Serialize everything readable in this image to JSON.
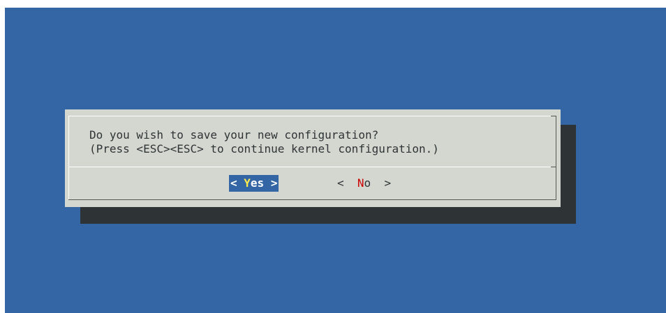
{
  "dialog": {
    "message_line1": "Do you wish to save your new configuration?",
    "message_line2": "(Press <ESC><ESC> to continue kernel configuration.)"
  },
  "buttons": {
    "yes": {
      "left": "<",
      "hotkey": "Y",
      "rest": "es",
      "right": ">"
    },
    "no": {
      "left": "<",
      "hotkey": "N",
      "rest": "o",
      "right": ">"
    }
  },
  "colors": {
    "background": "#3465a4",
    "dialog": "#d3d7cf",
    "shadow": "#2e3436",
    "selected_button": "#3465a4",
    "hotkey_selected": "#fce94f",
    "hotkey": "#cc0000"
  }
}
